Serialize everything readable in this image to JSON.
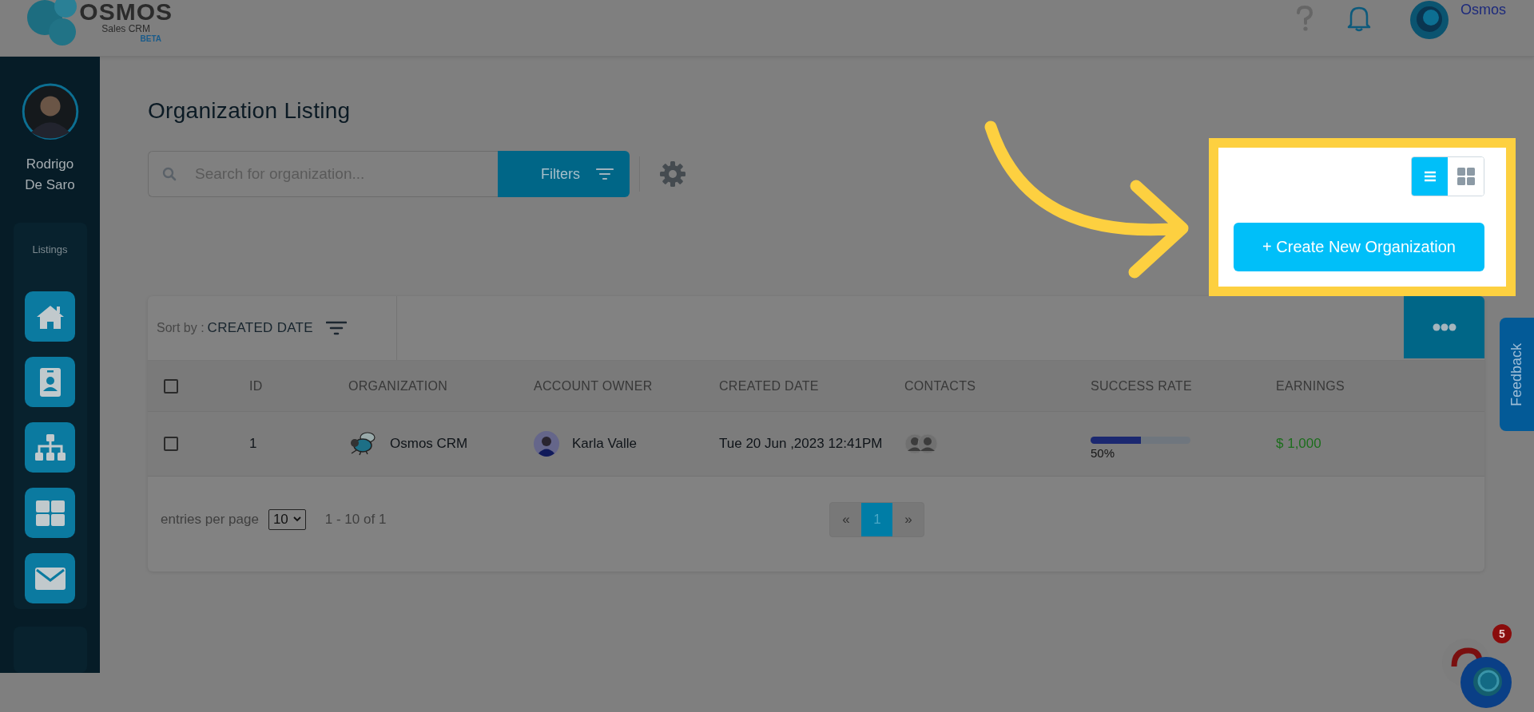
{
  "header": {
    "logo": {
      "name": "OSMOS",
      "subtitle": "Sales CRM",
      "badge": "BETA"
    },
    "user_name": "Osmos"
  },
  "sidebar": {
    "user": {
      "name": "Rodrigo De Saro"
    },
    "section_label": "Listings",
    "items": [
      {
        "kind": "home"
      },
      {
        "kind": "contact"
      },
      {
        "kind": "organization"
      },
      {
        "kind": "grid"
      },
      {
        "kind": "mail"
      }
    ]
  },
  "page": {
    "title": "Organization Listing",
    "search": {
      "placeholder": "Search for organization..."
    },
    "filters_button": "Filters",
    "view_toggle": [
      {
        "kind": "list",
        "selected": true
      },
      {
        "kind": "grid",
        "selected": false
      }
    ],
    "create_button": "+ Create New Organization"
  },
  "toolbar": {
    "sort_label": "Sort by :",
    "sort_value": "CREATED DATE"
  },
  "table": {
    "header_checked": false,
    "columns": [
      "ID",
      "ORGANIZATION",
      "ACCOUNT OWNER",
      "CREATED DATE",
      "CONTACTS",
      "SUCCESS RATE",
      "EARNINGS"
    ],
    "rows": [
      {
        "checked": false,
        "id": "1",
        "organization": "Osmos CRM",
        "owner": "Karla Valle",
        "created": "Tue 20 Jun ,2023 12:41PM",
        "success": {
          "level": 0.5,
          "reading": "50%"
        },
        "earnings": "$ 1,000"
      }
    ]
  },
  "footer": {
    "entries_label": "entries per page",
    "page_size": "10",
    "range": "1 - 10 of 1",
    "prev": "«",
    "pages": [
      {
        "label": "1",
        "selected": true
      }
    ],
    "next": "»"
  },
  "feedback_tab": "Feedback",
  "chat_badge": "5"
}
